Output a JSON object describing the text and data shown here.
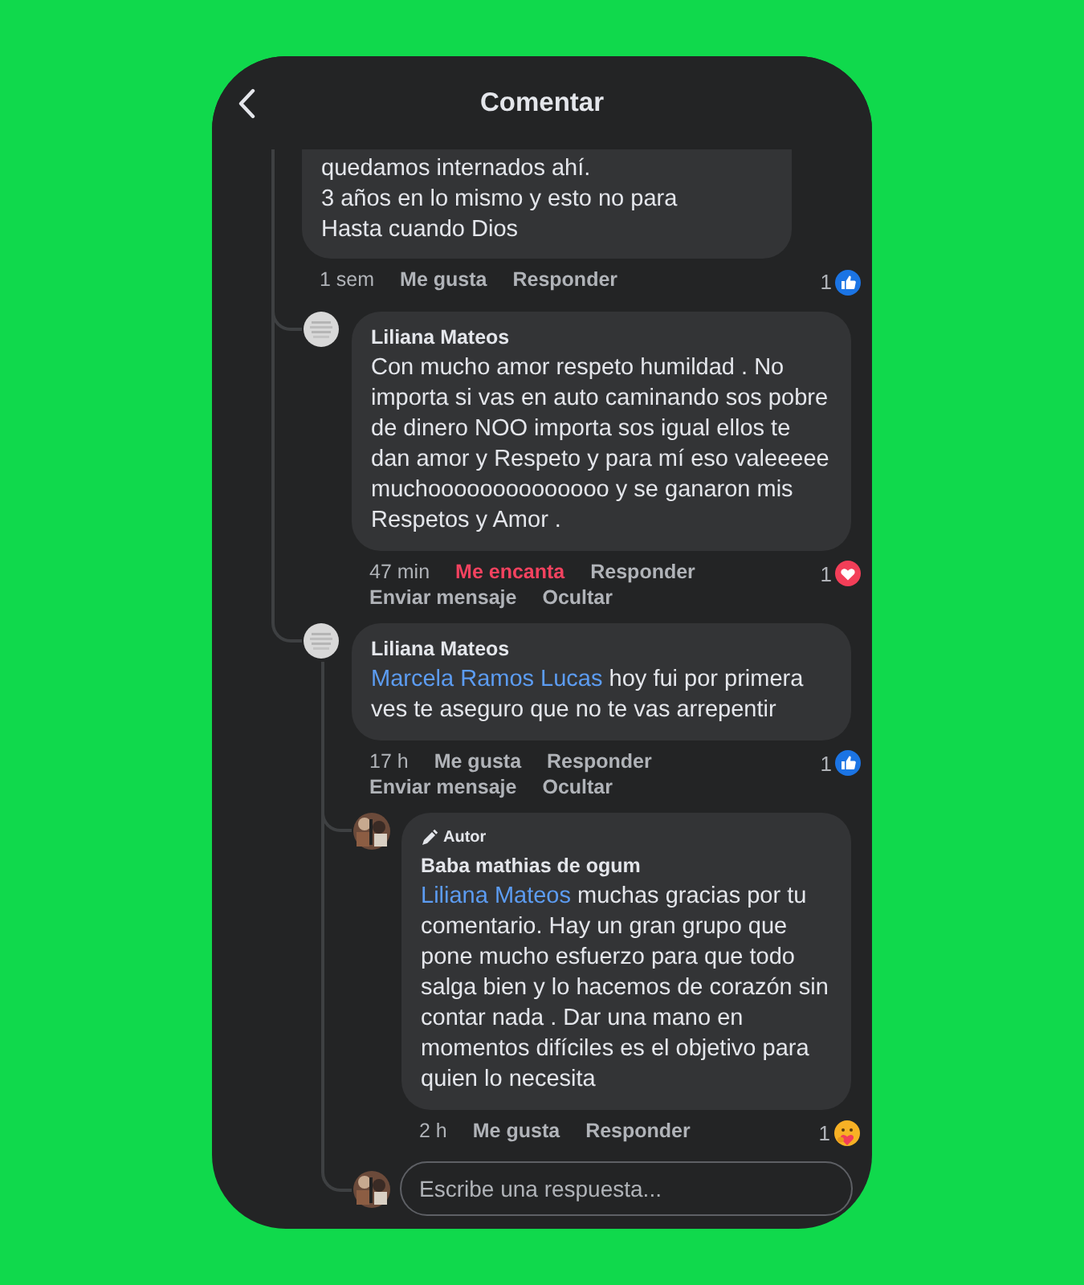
{
  "header": {
    "title": "Comentar"
  },
  "comments": [
    {
      "cut_top": true,
      "text": "quedamos internados ahí.\n3 años en lo mismo y esto no para\nHasta cuando Dios",
      "time": "1 sem",
      "actions": [
        {
          "label": "Me gusta",
          "active": false
        },
        {
          "label": "Responder",
          "active": false
        }
      ],
      "reaction": {
        "count": "1",
        "kind": "like"
      },
      "children": [
        {
          "author": "Liliana Mateos",
          "text": "Con mucho amor respeto humildad . No importa si vas en auto caminando sos pobre de dinero NOO importa sos igual ellos te dan amor y Respeto y para mí eso valeeeee muchoooooooooooooo y se ganaron mis Respetos y Amor .",
          "time": "47 min",
          "actions": [
            {
              "label": "Me encanta",
              "active": true
            },
            {
              "label": "Responder",
              "active": false
            },
            {
              "label": "Enviar mensaje",
              "active": false
            },
            {
              "label": "Ocultar",
              "active": false
            }
          ],
          "reaction": {
            "count": "1",
            "kind": "love"
          }
        },
        {
          "author": "Liliana Mateos",
          "mention": "Marcela Ramos Lucas",
          "text": "hoy fui por primera ves te aseguro que no te vas arrepentir",
          "time": "17 h",
          "actions": [
            {
              "label": "Me gusta",
              "active": false
            },
            {
              "label": "Responder",
              "active": false
            },
            {
              "label": "Enviar mensaje",
              "active": false
            },
            {
              "label": "Ocultar",
              "active": false
            }
          ],
          "reaction": {
            "count": "1",
            "kind": "like"
          },
          "children": [
            {
              "badge": "Autor",
              "author": "Baba mathias de ogum",
              "mention": "Liliana Mateos",
              "text": "muchas gracias por tu comentario. Hay un gran grupo que pone mucho esfuerzo para que todo salga bien y lo hacemos de corazón sin contar nada . Dar una mano en momentos difíciles es el objetivo para quien lo necesita",
              "time": "2 h",
              "actions": [
                {
                  "label": "Me gusta",
                  "active": false
                },
                {
                  "label": "Responder",
                  "active": false
                }
              ],
              "reaction": {
                "count": "1",
                "kind": "care"
              }
            }
          ],
          "reply_field": {
            "placeholder": "Escribe una respuesta..."
          }
        }
      ]
    }
  ]
}
